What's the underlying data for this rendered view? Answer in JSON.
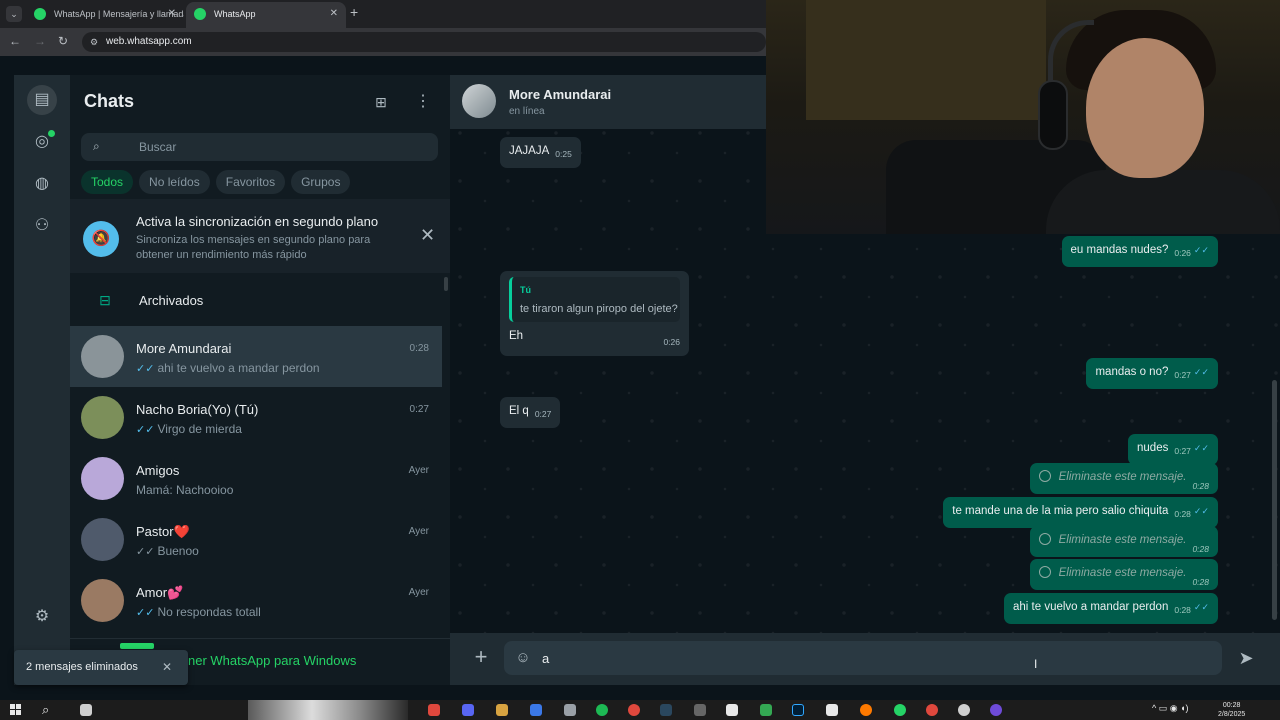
{
  "browser": {
    "tabs": [
      {
        "label": "WhatsApp | Mensajería y llamadas",
        "active": false
      },
      {
        "label": "WhatsApp",
        "active": true
      }
    ],
    "url": "web.whatsapp.com"
  },
  "sidebar": {
    "title": "Chats",
    "search_placeholder": "Buscar",
    "filters": [
      "Todos",
      "No leídos",
      "Favoritos",
      "Grupos"
    ],
    "active_filter": "Todos",
    "sync_banner": {
      "title": "Activa la sincronización en segundo plano",
      "description": "Sincroniza los mensajes en segundo plano para obtener un rendimiento más rápido"
    },
    "archived_label": "Archivados",
    "chats": [
      {
        "name": "More Amundarai",
        "time": "0:28",
        "preview": "ahi te vuelvo a mandar perdon",
        "ticks": true,
        "avatar_color": "#8a9499"
      },
      {
        "name": "Nacho Boria(Yo) (Tú)",
        "time": "0:27",
        "preview": "Virgo de mierda",
        "ticks": true,
        "avatar_color": "#7c8f5a"
      },
      {
        "name": "Amigos",
        "time": "Ayer",
        "preview": "Mamá: Nachooioo",
        "ticks": false,
        "avatar_color": "#b9a8d9"
      },
      {
        "name": "Pastor❤️",
        "time": "Ayer",
        "preview": "Buenoo",
        "ticks": true,
        "avatar_color": "#4f5a6b"
      },
      {
        "name": "Amor💕",
        "time": "Ayer",
        "preview": "No respondas totall",
        "ticks": true,
        "avatar_color": "#9a7a63"
      }
    ],
    "get_app_label": "ner WhatsApp para Windows"
  },
  "toast": {
    "text": "2 mensajes eliminados"
  },
  "conversation": {
    "contact_name": "More Amundarai",
    "contact_status": "en línea",
    "messages": [
      {
        "dir": "in",
        "text": "JAJAJA",
        "time": "0:25"
      },
      {
        "dir": "out",
        "text": "eu mandas nudes?",
        "time": "0:26"
      },
      {
        "dir": "in",
        "quote_author": "Tú",
        "quote_text": "te tiraron algun piropo del ojete?",
        "text": "Eh",
        "time": "0:26"
      },
      {
        "dir": "out",
        "text": "mandas o no?",
        "time": "0:27"
      },
      {
        "dir": "in",
        "text": "El q",
        "time": "0:27"
      },
      {
        "dir": "out",
        "text": "nudes",
        "time": "0:27"
      },
      {
        "dir": "out",
        "deleted": true,
        "text": "Eliminaste este mensaje.",
        "time": "0:28"
      },
      {
        "dir": "out",
        "text": "te mande una de la mia pero salio chiquita",
        "time": "0:28"
      },
      {
        "dir": "out",
        "deleted": true,
        "text": "Eliminaste este mensaje.",
        "time": "0:28"
      },
      {
        "dir": "out",
        "deleted": true,
        "text": "Eliminaste este mensaje.",
        "time": "0:28"
      },
      {
        "dir": "out",
        "text": "ahi te vuelvo a mandar perdon",
        "time": "0:28"
      }
    ],
    "composer_value": "a"
  },
  "taskbar": {
    "time": "00:28",
    "date": "2/8/2025"
  },
  "colors": {
    "accent": "#00a884",
    "bubble_out": "#005c4b",
    "bubble_in": "#202c33",
    "read_tick": "#53bdeb"
  }
}
